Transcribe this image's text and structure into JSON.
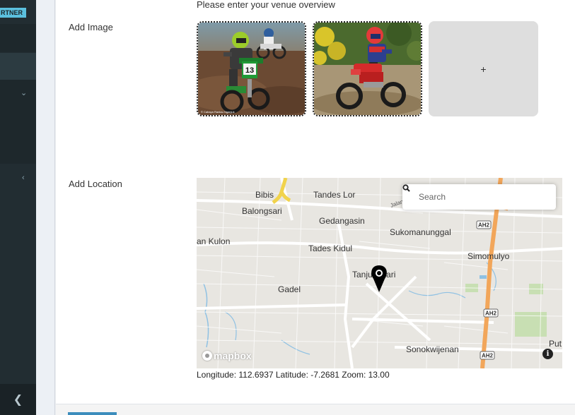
{
  "sidebar": {
    "badge": "RTNER",
    "footer_icon": "chevron-left-icon"
  },
  "form": {
    "overview_hint": "Please enter your venue overview",
    "add_image_label": "Add Image",
    "add_image_button": "+",
    "add_location_label": "Add Location"
  },
  "images": [
    {
      "name": "motocross-rider-green-bike",
      "plate": "13",
      "caption": "© Cahaya Rantau Nganjuk"
    },
    {
      "name": "motocross-rider-red-bike"
    }
  ],
  "map": {
    "search_placeholder": "Search",
    "attribution": "mapbox",
    "info_icon": "info-icon",
    "place_labels": [
      "Bibis",
      "Tandes Lor",
      "Balongsari",
      "Gedangasin",
      "Sukomanunggal",
      "an Kulon",
      "Tades Kidul",
      "Simomulyo",
      "Tanjungsari",
      "Gadel",
      "Sonokwijenan",
      "Put"
    ],
    "road_labels": [
      "Jalan Tandes",
      "AH2",
      "AH2",
      "AH2"
    ],
    "coordinates_text": "Longitude: 112.6937 Latitude: -7.2681 Zoom: 13.00"
  },
  "colors": {
    "sidebar": "#222d32",
    "badge": "#5bc0de",
    "primary_button": "#3c8dbc",
    "highway": "#f2a65a",
    "water": "#8fc1e3",
    "park": "#c8dfb3"
  }
}
